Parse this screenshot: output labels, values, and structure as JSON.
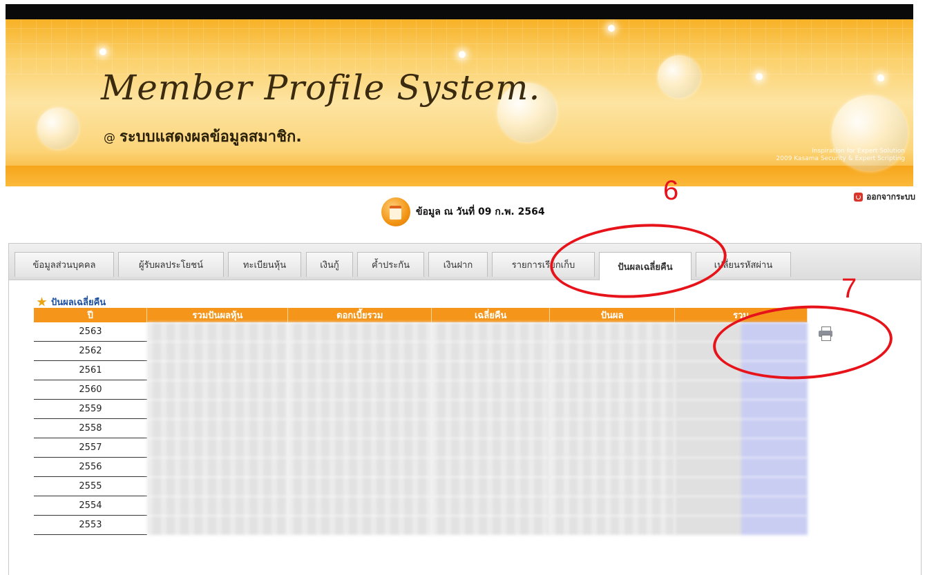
{
  "header": {
    "title": "Member Profile System.",
    "subtitle_at": "@",
    "subtitle": "ระบบแสดงผลข้อมูลสมาชิก.",
    "credit_line1": "Inspiration for Expert Solution",
    "credit_line2": "2009 Kasama Security & Expert Scripting"
  },
  "logout_label": "ออกจากระบบ",
  "date_text": "ข้อมูล ณ วันที่ 09 ก.พ. 2564",
  "tabs": [
    {
      "label": "ข้อมูลส่วนบุคคล"
    },
    {
      "label": "ผู้รับผลประโยชน์"
    },
    {
      "label": "ทะเบียนหุ้น"
    },
    {
      "label": "เงินกู้"
    },
    {
      "label": "ค้ำประกัน"
    },
    {
      "label": "เงินฝาก"
    },
    {
      "label": "รายการเรียกเก็บ"
    },
    {
      "label": "ปันผลเฉลี่ยคืน",
      "active": true
    },
    {
      "label": "เปลี่ยนรหัสผ่าน"
    }
  ],
  "section_title": "ปันผลเฉลี่ยคืน",
  "table": {
    "headers": [
      "ปี",
      "รวมปันผลหุ้น",
      "ดอกเบี้ยรวม",
      "เฉลี่ยคืน",
      "ปันผล",
      "รวม"
    ],
    "years": [
      "2563",
      "2562",
      "2561",
      "2560",
      "2559",
      "2558",
      "2557",
      "2556",
      "2555",
      "2554",
      "2553"
    ]
  },
  "annotations": {
    "six": "6",
    "seven": "7"
  },
  "colors": {
    "accent_orange": "#f5961a",
    "annotation_red": "#e6141a",
    "link_blue": "#1c4fa0"
  }
}
